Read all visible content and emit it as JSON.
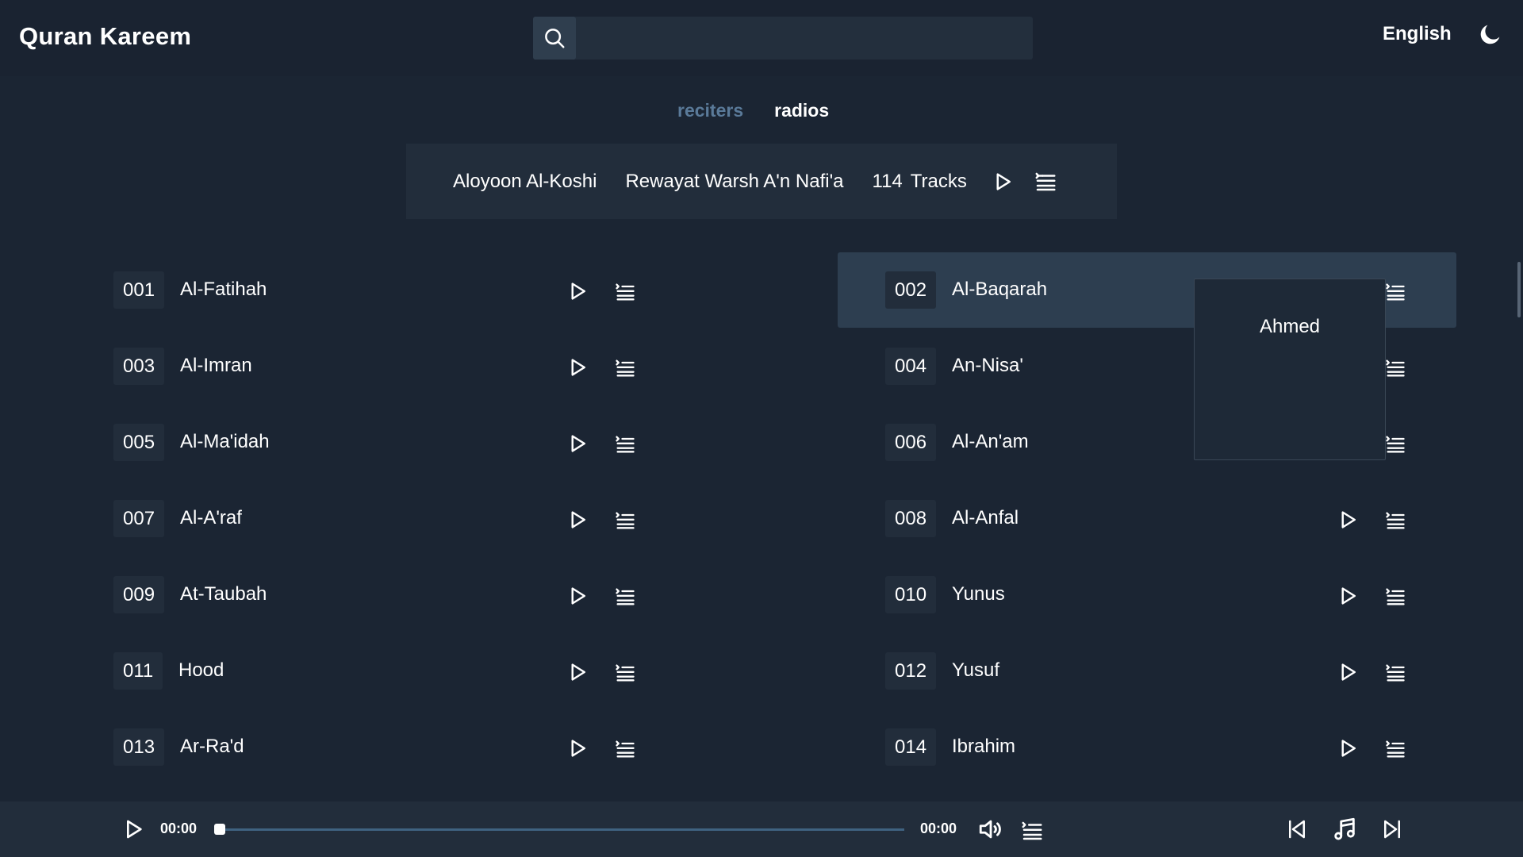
{
  "header": {
    "brand": "Quran Kareem",
    "search_placeholder": "",
    "language": "English",
    "icons": {
      "search": "search-icon",
      "theme": "moon-icon"
    }
  },
  "tabs": [
    {
      "label": "reciters",
      "active": true
    },
    {
      "label": "radios",
      "active": false
    }
  ],
  "reciter_bar": {
    "name": "Aloyoon Al-Koshi",
    "rewaya": "Rewayat Warsh A'n Nafi'a",
    "track_count": "114",
    "tracks_label": "Tracks"
  },
  "tracks": [
    {
      "number": "001",
      "title": "Al-Fatihah"
    },
    {
      "number": "002",
      "title": "Al-Baqarah"
    },
    {
      "number": "003",
      "title": "Al-Imran"
    },
    {
      "number": "004",
      "title": "An-Nisa'"
    },
    {
      "number": "005",
      "title": "Al-Ma'idah"
    },
    {
      "number": "006",
      "title": "Al-An'am"
    },
    {
      "number": "007",
      "title": "Al-A'raf"
    },
    {
      "number": "008",
      "title": "Al-Anfal"
    },
    {
      "number": "009",
      "title": "At-Taubah"
    },
    {
      "number": "010",
      "title": "Yunus"
    },
    {
      "number": "011",
      "title": "Hood"
    },
    {
      "number": "012",
      "title": "Yusuf"
    },
    {
      "number": "013",
      "title": "Ar-Ra'd"
    },
    {
      "number": "014",
      "title": "Ibrahim"
    }
  ],
  "popup": {
    "items": [
      "Ahmed"
    ]
  },
  "player": {
    "current_time": "00:00",
    "duration": "00:00",
    "progress": 0
  },
  "colors": {
    "background": "#1b2533",
    "panel": "#222d3b",
    "highlight": "#2d3e50",
    "active_tab": "#5a7a99",
    "progress": "#3f6280"
  }
}
